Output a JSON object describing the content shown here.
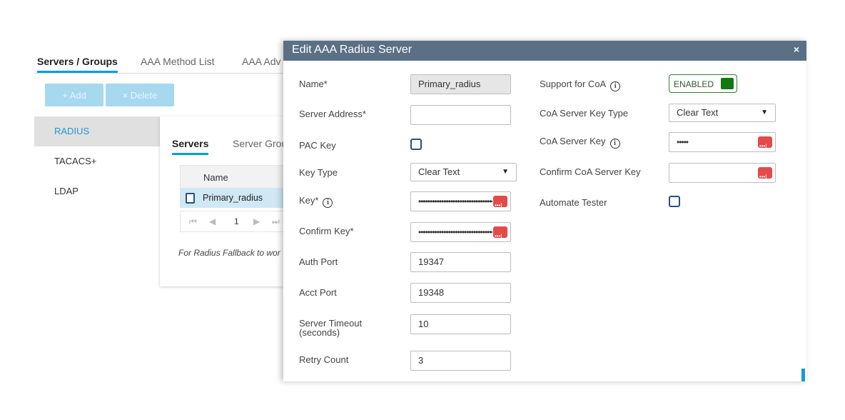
{
  "top_tabs": [
    "Servers / Groups",
    "AAA Method List",
    "AAA Adv"
  ],
  "toolbar": {
    "add_label": "+ Add",
    "delete_label": "× Delete"
  },
  "sidebar": {
    "items": [
      "RADIUS",
      "TACACS+",
      "LDAP"
    ]
  },
  "inner_tabs": [
    "Servers",
    "Server Grou"
  ],
  "grid": {
    "column_name": "Name",
    "rows": [
      {
        "name": "Primary_radius"
      }
    ],
    "pager": {
      "first": "⏮",
      "prev": "◀",
      "page": "1",
      "next": "▶",
      "last": "⏭"
    }
  },
  "fallback_text": "For Radius Fallback to wor",
  "modal": {
    "title": "Edit AAA Radius Server",
    "close": "×",
    "left": {
      "name_label": "Name*",
      "name_value": "Primary_radius",
      "server_address_label": "Server Address*",
      "server_address_value": "",
      "pac_key_label": "PAC Key",
      "key_type_label": "Key Type",
      "key_type_value": "Clear Text",
      "key_label": "Key*",
      "key_mask": "••••••••••••••••••••••••••••••••••••",
      "confirm_key_label": "Confirm Key*",
      "confirm_key_mask": "••••••••••••••••••••••••••••••••••••",
      "auth_port_label": "Auth Port",
      "auth_port_value": "19347",
      "acct_port_label": "Acct Port",
      "acct_port_value": "19348",
      "timeout_label_1": "Server Timeout",
      "timeout_label_2": "(seconds)",
      "timeout_value": "10",
      "retry_label": "Retry Count",
      "retry_value": "3"
    },
    "right": {
      "coa_support_label": "Support for CoA",
      "coa_support_value": "ENABLED",
      "coa_key_type_label": "CoA Server Key Type",
      "coa_key_type_value": "Clear Text",
      "coa_key_label": "CoA Server Key",
      "coa_key_mask": "•••••",
      "confirm_coa_key_label": "Confirm CoA Server Key",
      "automate_tester_label": "Automate Tester"
    }
  },
  "colors": {
    "header": "#5b7085",
    "accent": "#049fd9",
    "reveal": "#e34b4b",
    "toggle_on": "#117711"
  }
}
